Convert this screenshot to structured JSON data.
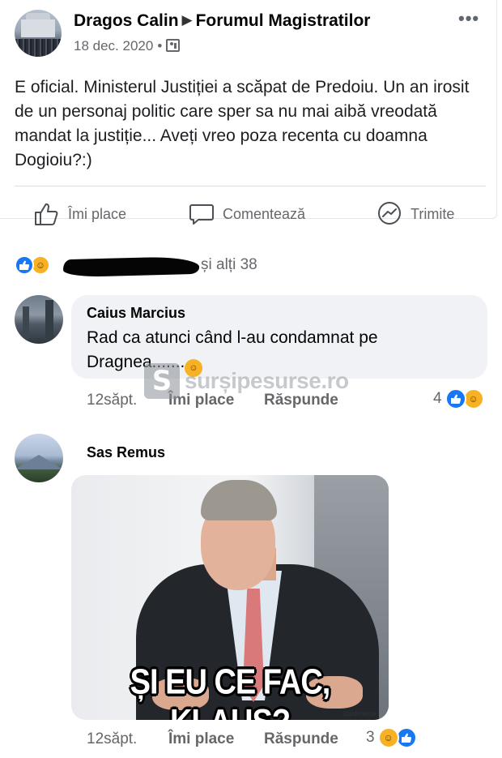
{
  "post": {
    "author": "Dragos Calin",
    "group": "Forumul Magistratilor",
    "date": "18 dec. 2020",
    "dot": "•",
    "text": "E oficial. Ministerul Justiției a scăpat de Predoiu. Un an irosit de un personaj politic care sper sa nu mai aibă vreodată mandat la justiție... Aveți vreo poza recenta cu doamna Dogioiu?:)",
    "actions": {
      "like": "Îmi place",
      "comment": "Comentează",
      "share": "Trimite"
    }
  },
  "reactions": {
    "text": "și alți 38",
    "icons": [
      "like-icon",
      "haha-icon"
    ]
  },
  "comments": [
    {
      "author": "Caius Marcius",
      "text": "Rad ca atunci când l-au condamnat pe Dragnea.......",
      "time": "12săpt.",
      "like_label": "Îmi place",
      "reply_label": "Răspunde",
      "reaction_count": "4"
    },
    {
      "author": "Sas Remus",
      "image_caption": "ȘI EU CE FAC, KLAUS?",
      "image_watermark": "quickmeme",
      "time": "12săpt.",
      "like_label": "Îmi place",
      "reply_label": "Răspunde",
      "reaction_count": "3"
    }
  ],
  "watermark": {
    "logo_letter": "S",
    "text": "surșipesurse.ro"
  },
  "colors": {
    "accent": "#1877f2",
    "haha": "#f7b125",
    "muted": "#65676b",
    "bubble": "#f0f2f5"
  }
}
